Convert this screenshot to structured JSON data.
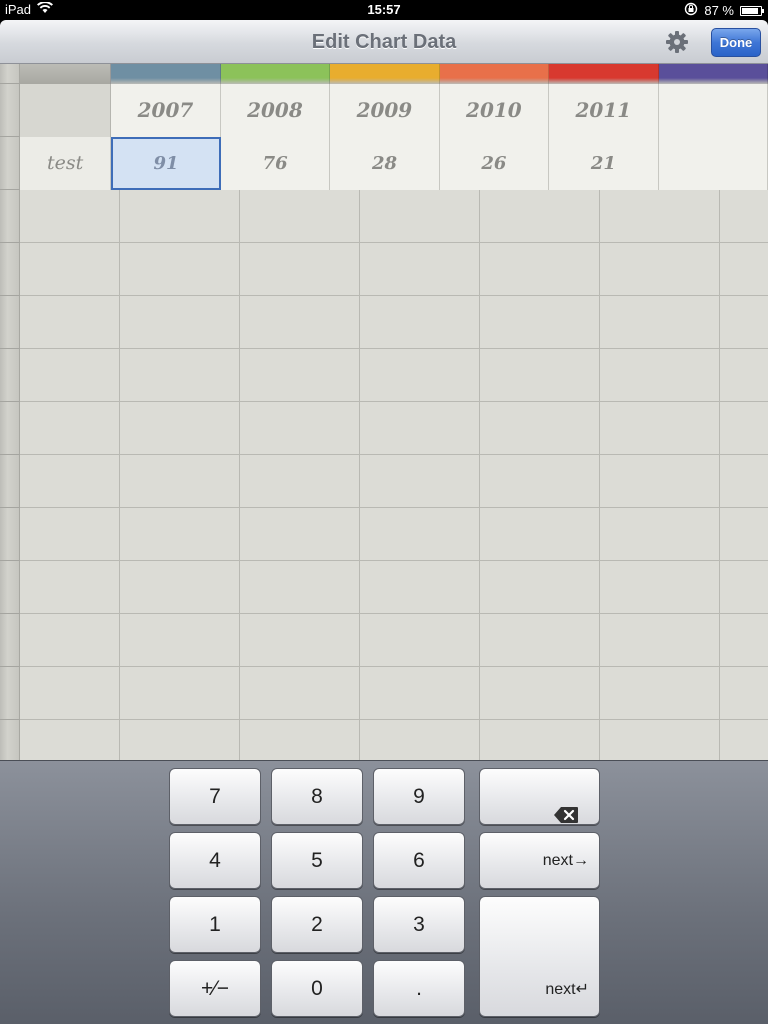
{
  "status_bar": {
    "device": "iPad",
    "time": "15:57",
    "battery_percent": "87 %",
    "battery_level": 0.87
  },
  "nav": {
    "title": "Edit Chart Data",
    "done_label": "Done"
  },
  "sheet": {
    "series_colors": [
      "#6f8fa3",
      "#8cc25a",
      "#e8ad2e",
      "#e8704a",
      "#d8392f",
      "#5a4f9a"
    ],
    "years": [
      "2007",
      "2008",
      "2009",
      "2010",
      "2011"
    ],
    "rows": [
      {
        "label": "test",
        "values": [
          "91",
          "76",
          "28",
          "26",
          "21"
        ]
      }
    ],
    "selected_cell": {
      "row": 0,
      "col": 0
    }
  },
  "keyboard": {
    "keys": {
      "k7": "7",
      "k8": "8",
      "k9": "9",
      "k4": "4",
      "k5": "5",
      "k6": "6",
      "k1": "1",
      "k2": "2",
      "k3": "3",
      "kpm": "+⁄−",
      "k0": "0",
      "kdot": ".",
      "next_right": "next→",
      "next_return": "next↵"
    }
  }
}
